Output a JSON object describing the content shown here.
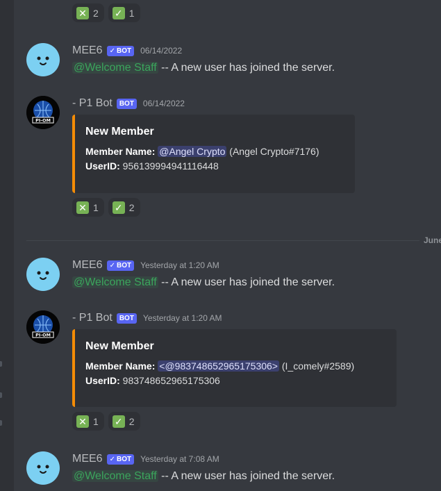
{
  "top_reactions": [
    {
      "emoji": "cross-mark-icon",
      "count": "2"
    },
    {
      "emoji": "check-mark-icon",
      "count": "1"
    }
  ],
  "messages": [
    {
      "username": "MEE6",
      "bot_tag": "BOT",
      "bot_verified": true,
      "timestamp": "06/14/2022",
      "mention": "@Welcome Staff",
      "text": " -- A new user has joined the server."
    },
    {
      "username": "- P1 Bot",
      "bot_tag": "BOT",
      "timestamp": "06/14/2022",
      "embed": {
        "title": "New Member",
        "member_name_label": "Member Name:",
        "member_mention": "@Angel Crypto",
        "member_tag": " (Angel Crypto#7176)",
        "userid_label": "UserID:",
        "userid": " 956139994941116448"
      },
      "reactions": [
        {
          "count": "1"
        },
        {
          "count": "2"
        }
      ]
    },
    {
      "username": "MEE6",
      "bot_tag": "BOT",
      "timestamp": "Yesterday at 1:20 AM",
      "mention": "@Welcome Staff",
      "text": " -- A new user has joined the server."
    },
    {
      "username": "- P1 Bot",
      "bot_tag": "BOT",
      "timestamp": "Yesterday at 1:20 AM",
      "embed": {
        "title": "New Member",
        "member_name_label": "Member Name:",
        "member_mention": "<@983748652965175306>",
        "member_tag": " (I_comely#2589)",
        "userid_label": "UserID:",
        "userid": " 983748652965175306"
      },
      "reactions": [
        {
          "count": "1"
        },
        {
          "count": "2"
        }
      ]
    },
    {
      "username": "MEE6",
      "bot_tag": "BOT",
      "timestamp": "Yesterday at 7:08 AM",
      "mention": "@Welcome Staff",
      "text": " -- A new user has joined the server."
    }
  ],
  "divider_label": "June",
  "colors": {
    "background": "#36393f",
    "embed_bar": "#f48c06",
    "bot_tag": "#5865f2",
    "role_mention": "#3ba55c",
    "user_mention": "#5865f2"
  }
}
